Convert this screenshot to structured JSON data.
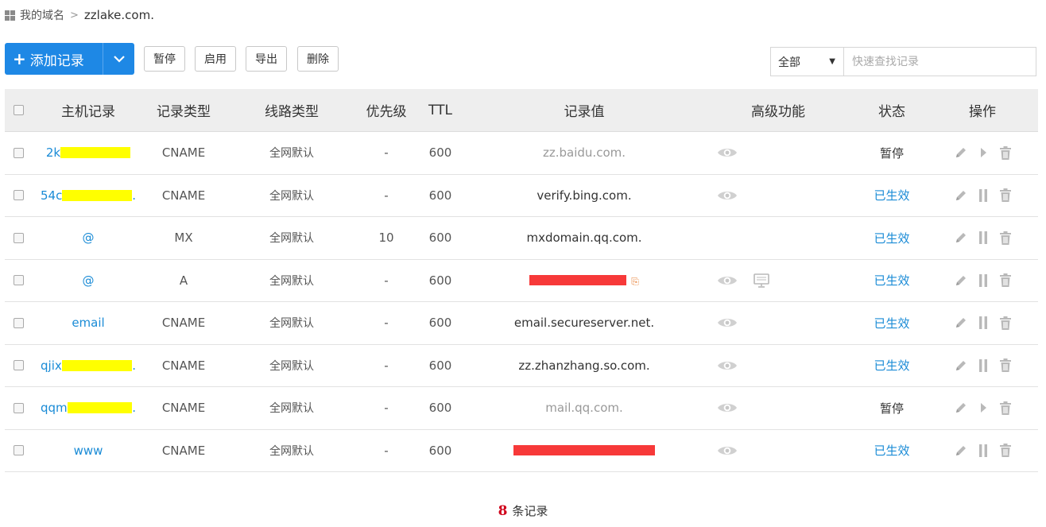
{
  "breadcrumb": {
    "root": "我的域名",
    "separator": ">",
    "current": "zzlake.com."
  },
  "toolbar": {
    "add_label": "添加记录",
    "pause_label": "暂停",
    "enable_label": "启用",
    "export_label": "导出",
    "delete_label": "删除",
    "filter_value": "全部",
    "search_placeholder": "快速查找记录"
  },
  "table": {
    "columns": [
      "主机记录",
      "记录类型",
      "线路类型",
      "优先级",
      "TTL",
      "记录值",
      "高级功能",
      "状态",
      "操作"
    ],
    "rows": [
      {
        "host": "2k",
        "host_tail": "",
        "type": "CNAME",
        "line": "全网默认",
        "priority": "-",
        "ttl": "600",
        "value": "zz.baidu.com.",
        "status": "暂停"
      },
      {
        "host": "54c",
        "host_tail": ".",
        "type": "CNAME",
        "line": "全网默认",
        "priority": "-",
        "ttl": "600",
        "value": "verify.bing.com.",
        "status": "已生效"
      },
      {
        "host": "@",
        "type": "MX",
        "line": "全网默认",
        "priority": "10",
        "ttl": "600",
        "value": "mxdomain.qq.com.",
        "status": "已生效"
      },
      {
        "host": "@",
        "type": "A",
        "line": "全网默认",
        "priority": "-",
        "ttl": "600",
        "value": "",
        "status": "已生效"
      },
      {
        "host": "email",
        "type": "CNAME",
        "line": "全网默认",
        "priority": "-",
        "ttl": "600",
        "value": "email.secureserver.net.",
        "status": "已生效"
      },
      {
        "host": "qjix",
        "host_tail": ".",
        "type": "CNAME",
        "line": "全网默认",
        "priority": "-",
        "ttl": "600",
        "value": "zz.zhanzhang.so.com.",
        "status": "已生效"
      },
      {
        "host": "qqm",
        "host_tail": ".",
        "type": "CNAME",
        "line": "全网默认",
        "priority": "-",
        "ttl": "600",
        "value": "mail.qq.com.",
        "status": "暂停"
      },
      {
        "host": "www",
        "type": "CNAME",
        "line": "全网默认",
        "priority": "-",
        "ttl": "600",
        "value": "",
        "status": "已生效"
      }
    ]
  },
  "footer": {
    "count": "8",
    "label": "条记录"
  },
  "colors": {
    "primary": "#1e88e5",
    "link": "#1a8bd6",
    "highlight": "#ffff00",
    "redaction": "#f73939",
    "count": "#d0021b"
  },
  "icons": [
    "grid-icon",
    "plus-icon",
    "chevron-down-icon",
    "eye-icon",
    "monitor-icon",
    "tag-icon",
    "edit-icon",
    "play-icon",
    "pause-icon",
    "trash-icon"
  ]
}
